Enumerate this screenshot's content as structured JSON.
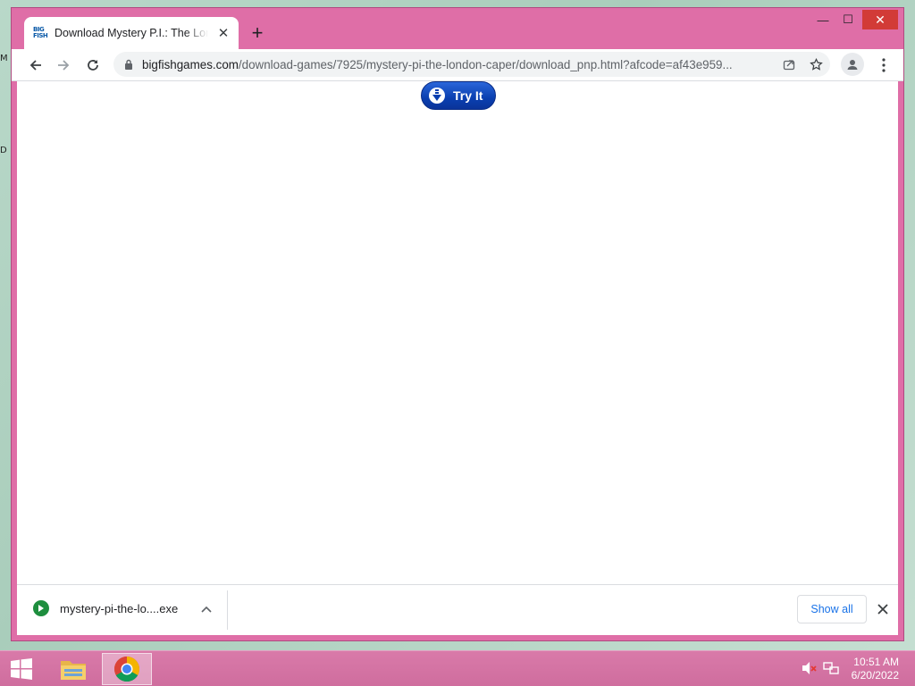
{
  "desktop": {
    "stub1": "M",
    "stub2": "D"
  },
  "window": {
    "tab": {
      "favicon_text_1": "BIG",
      "favicon_text_2": "FISH",
      "title": "Download Mystery P.I.: The London Caper",
      "close_symbol": "✕"
    },
    "newtab_symbol": "+",
    "controls": {
      "minimize": "—",
      "maximize": "☐",
      "close": "✕"
    }
  },
  "toolbar": {
    "url_host": "bigfishgames.com",
    "url_path": "/download-games/7925/mystery-pi-the-london-caper/download_pnp.html?afcode=af43e959..."
  },
  "content": {
    "try_button_label": "Try It"
  },
  "download_shelf": {
    "file_name": "mystery-pi-the-lo....exe",
    "show_all_label": "Show all"
  },
  "taskbar": {
    "clock_time": "10:51 AM",
    "clock_date": "6/20/2022"
  },
  "colors": {
    "window_frame": "#df6ea7",
    "taskbar": "#cf6d9e",
    "try_button": "#0a3fb0",
    "accent_blue": "#1a73e8",
    "download_green": "#1e8e3e"
  }
}
